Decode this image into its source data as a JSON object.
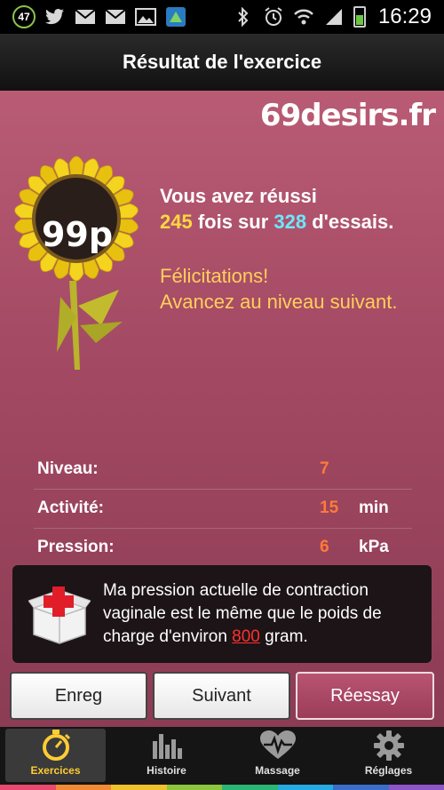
{
  "status_bar": {
    "badge": "47",
    "time": "16:29",
    "icons": [
      "twitter-icon",
      "mail-icon",
      "mail-icon",
      "image-icon",
      "app-icon",
      "bluetooth-icon",
      "alarm-icon",
      "wifi-icon",
      "signal-icon",
      "battery-icon"
    ]
  },
  "header": {
    "title": "Résultat de l'exercice"
  },
  "brand": {
    "logo_text": "69desirs.fr"
  },
  "result": {
    "score": "99p",
    "line1": "Vous avez réussi",
    "success_count": "245",
    "middle": " fois sur ",
    "total_count": "328",
    "suffix": " d'essais.",
    "congrats": "Félicitations!",
    "next_level": "Avancez au niveau suivant."
  },
  "stats": [
    {
      "label": "Niveau:",
      "value": "7",
      "unit": ""
    },
    {
      "label": "Activité:",
      "value": "15",
      "unit": "min"
    },
    {
      "label": "Pression:",
      "value": "6",
      "unit": "kPa"
    }
  ],
  "info": {
    "text_before": "Ma pression actuelle de contraction vaginale est le même que le poids de charge d'environ ",
    "weight": "800",
    "text_after": " gram."
  },
  "buttons": {
    "save": "Enreg",
    "next": "Suivant",
    "retry": "Réessay"
  },
  "tabs": [
    {
      "label": "Exercices",
      "icon": "stopwatch-icon",
      "active": true
    },
    {
      "label": "Histoire",
      "icon": "bar-chart-icon",
      "active": false
    },
    {
      "label": "Massage",
      "icon": "heart-pulse-icon",
      "active": false
    },
    {
      "label": "Réglages",
      "icon": "gear-icon",
      "active": false
    }
  ],
  "colors": {
    "background": "#a24862",
    "accent_yellow": "#ffd740",
    "accent_cyan": "#6ee7ff",
    "accent_orange": "#ff7a3a",
    "tab_active": "#ffcc33"
  }
}
